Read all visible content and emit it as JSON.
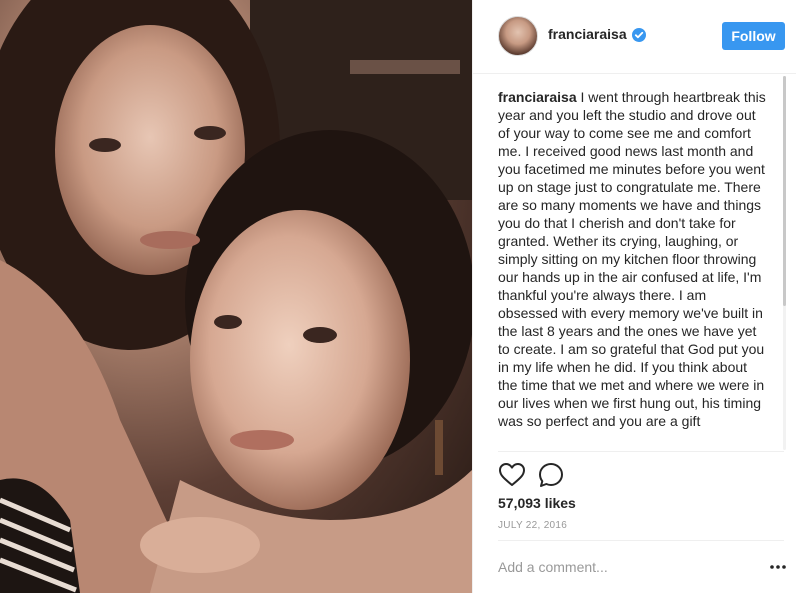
{
  "post": {
    "username": "franciaraisa",
    "follow_label": "Follow",
    "caption_text": "I went through heartbreak this year and you left the studio and drove out of your way to come see me and comfort me. I received good news last month and you facetimed me minutes before you went up on stage just to congratulate me. There are so many moments we have and things you do that I cherish and don't take for granted. Wether its crying, laughing, or simply sitting on my kitchen floor throwing our hands up in the air confused at life, I'm thankful you're always there. I am obsessed with every memory we've built in the last 8 years and the ones we have yet to create. I am so grateful that God put you in my life when he did. If you think about the time that we met and where we were in our lives when we first hung out, his timing was so perfect and you are a gift",
    "likes": "57,093 likes",
    "date": "JULY 22, 2016",
    "comment_placeholder": "Add a comment..."
  },
  "icons": {
    "verified": "verified-badge-icon",
    "like": "heart-icon",
    "comment": "comment-bubble-icon",
    "more": "more-options-icon"
  },
  "colors": {
    "follow_button": "#3897f0",
    "verified": "#3897f0",
    "text": "#262626",
    "muted": "#999999",
    "divider": "#efefef"
  }
}
